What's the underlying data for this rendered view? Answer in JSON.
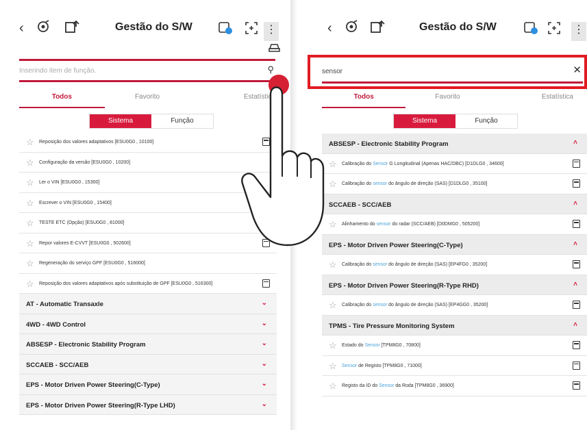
{
  "left": {
    "header": {
      "title": "Gestão do S/W"
    },
    "search": {
      "placeholder": "Inserindo item de função."
    },
    "tabs": [
      "Todos",
      "Favorito",
      "Estatística"
    ],
    "segment": {
      "on": "Sistema",
      "off": "Função"
    },
    "items": [
      "Reposição dos valores adaptativos [ESU0G0 , 10100]",
      "Configuração da versão [ESU0G0 , 10200]",
      "Ler o VIN [ESU0G0 , 15300]",
      "Escrever o VIN [ESU0G0 , 15400]",
      "TESTE ETC (Opção) [ESU0G0 , 81000]",
      "Repor valores E-CVVT [ESU0G0 , 502600]",
      "Regeneração do serviço GPF [ESU0G0 , 516000]",
      "Reposição dos valores adaptativos após substituição de GPF [ESU0G0 , 516300]"
    ],
    "sections": [
      "AT - Automatic Transaxle",
      "4WD - 4WD Control",
      "ABSESP - Electronic Stability Program",
      "SCCAEB - SCC/AEB",
      "EPS - Motor Driven Power Steering(C-Type)",
      "EPS - Motor Driven Power Steering(R-Type LHD)"
    ]
  },
  "right": {
    "header": {
      "title": "Gestão do S/W"
    },
    "search": {
      "value": "sensor"
    },
    "tabs": [
      "Todos",
      "Favorito",
      "Estatística"
    ],
    "segment": {
      "on": "Sistema",
      "off": "Função"
    },
    "groups": [
      {
        "title": "ABSESP - Electronic Stability Program",
        "items": [
          [
            "Calibração do ",
            "Sensor",
            " G Longitudinal (Apenas HAC/DBC) [D1DLG0 , 34600]"
          ],
          [
            "Calibração do ",
            "sensor",
            " do ângulo de direção (SAS) [D1DLG0 , 35100]"
          ]
        ]
      },
      {
        "title": "SCCAEB - SCC/AEB",
        "items": [
          [
            "Alinhamento do ",
            "sensor",
            " do radar (SCC/AEB) [D0DMG0 , 505200]"
          ]
        ]
      },
      {
        "title": "EPS - Motor Driven Power Steering(C-Type)",
        "items": [
          [
            "Calibração do ",
            "sensor",
            " do ângulo de direção (SAS) [EP4FG0 , 35200]"
          ]
        ]
      },
      {
        "title": "EPS - Motor Driven Power Steering(R-Type RHD)",
        "items": [
          [
            "Calibração do ",
            "sensor",
            " do ângulo de direção (SAS) [EP4GG0 , 35200]"
          ]
        ]
      },
      {
        "title": "TPMS - Tire Pressure Monitoring System",
        "items": [
          [
            "Estado do ",
            "Sensor",
            " [TPM8G0 , 70800]"
          ],
          [
            "",
            "Sensor",
            " de Registo [TPM8G0 , 71000]"
          ],
          [
            "Registo da ID do ",
            "Sensor",
            " da Roda [TPM8G0 , 36900]"
          ]
        ]
      }
    ]
  },
  "colors": {
    "accent": "#d81b3d",
    "callout": "#e11b22",
    "highlight": "#4aa3d6"
  }
}
